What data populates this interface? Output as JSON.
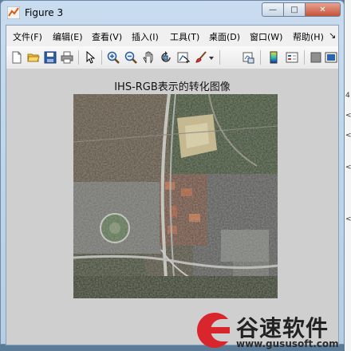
{
  "window": {
    "title": "Figure 3",
    "buttons": {
      "minimize": "—",
      "maximize": "□",
      "close": "✕"
    }
  },
  "menubar": {
    "items": [
      {
        "label": "文件(F)"
      },
      {
        "label": "编辑(E)"
      },
      {
        "label": "查看(V)"
      },
      {
        "label": "插入(I)"
      },
      {
        "label": "工具(T)"
      },
      {
        "label": "桌面(D)"
      },
      {
        "label": "窗口(W)"
      },
      {
        "label": "帮助(H)"
      }
    ],
    "overflow": "↘"
  },
  "toolbar": {
    "icons": [
      "new-figure-icon",
      "open-file-icon",
      "save-icon",
      "print-icon",
      "pointer-icon",
      "zoom-in-icon",
      "zoom-out-icon",
      "pan-icon",
      "rotate-3d-icon",
      "data-cursor-icon",
      "brush-icon",
      "dropdown-arrow-icon",
      "link-plot-icon",
      "colorbar-icon",
      "legend-icon",
      "hide-plot-tools-icon",
      "show-plot-tools-icon"
    ]
  },
  "figure": {
    "title": "IHS-RGB表示的转化图像"
  },
  "desktop": {
    "edge_glyphs": [
      "4",
      "<",
      "<",
      "<",
      "<"
    ]
  },
  "watermark": {
    "text": "谷速软件",
    "url": "www.gususoft.com"
  },
  "colors": {
    "titlebar": "#c9dcef",
    "client_bg": "#d4d4d4",
    "close_button": "#c6523a",
    "watermark_red": "#d8262c"
  }
}
